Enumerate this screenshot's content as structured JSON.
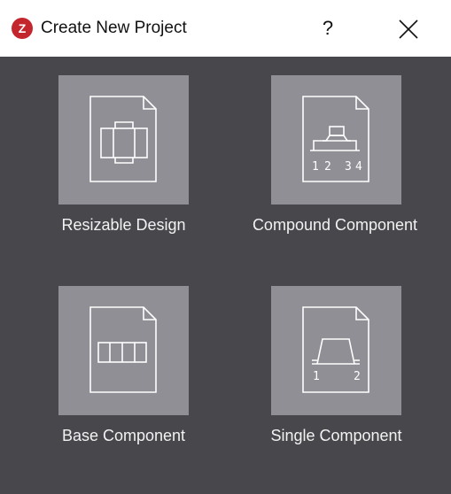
{
  "window": {
    "title": "Create New Project",
    "help_label": "?",
    "icons": {
      "logo": "app-logo-icon",
      "close": "close-icon"
    }
  },
  "options": [
    {
      "label": "Resizable Design",
      "icon": "resizable-design-icon"
    },
    {
      "label": "Compound Component",
      "icon": "compound-component-icon",
      "pin_labels": [
        "1",
        "2",
        "3",
        "4"
      ]
    },
    {
      "label": "Base Component",
      "icon": "base-component-icon"
    },
    {
      "label": "Single Component",
      "icon": "single-component-icon",
      "pin_labels": [
        "1",
        "2"
      ]
    }
  ],
  "colors": {
    "dialog_background": "#48474c",
    "tile_background": "#8f8f95",
    "logo_red": "#c4262e"
  }
}
